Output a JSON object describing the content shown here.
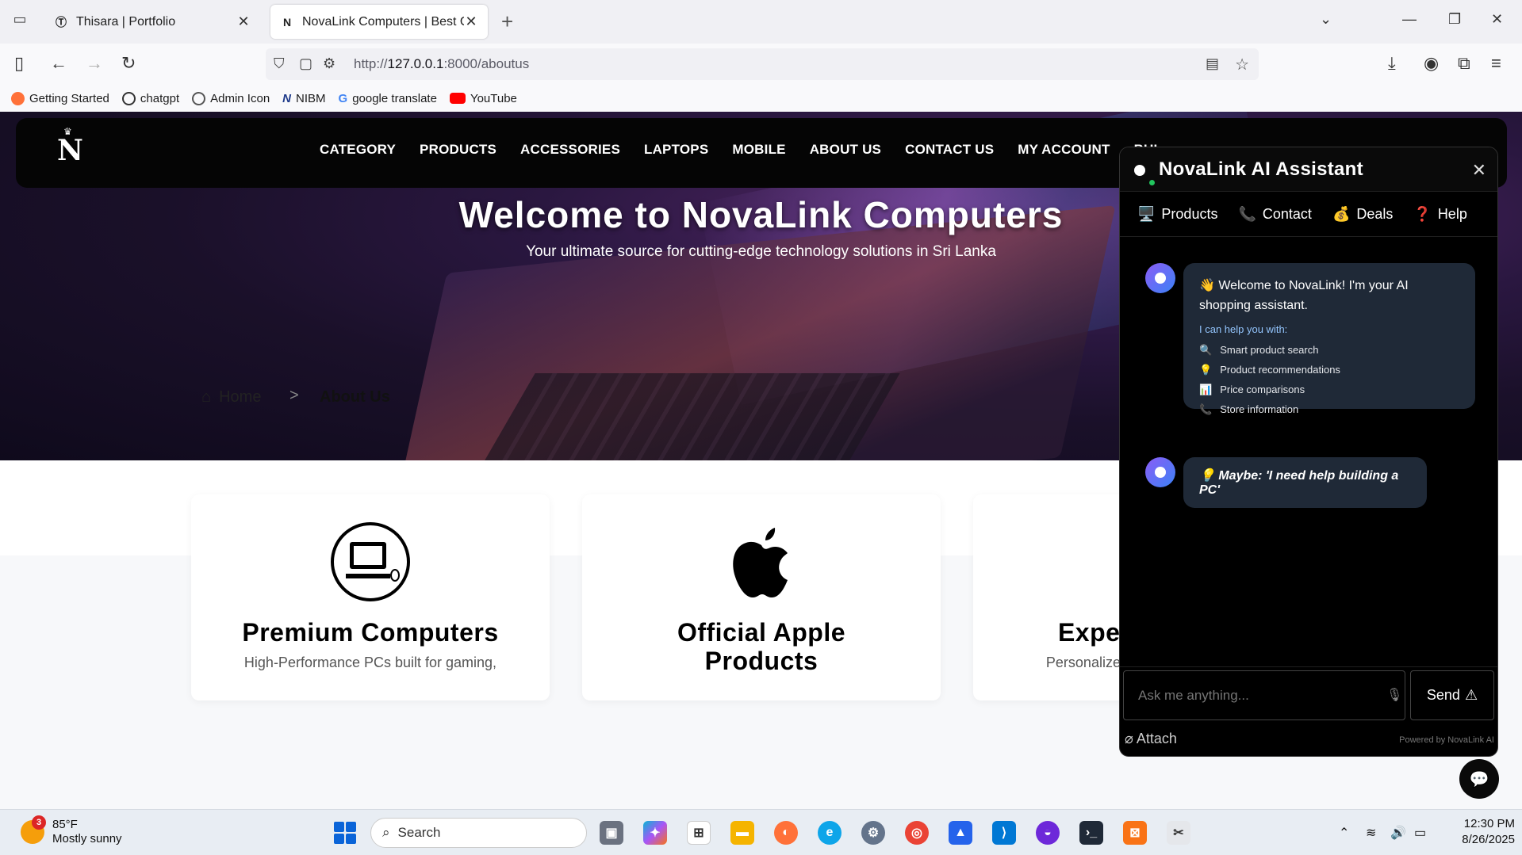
{
  "browser": {
    "tabs": [
      {
        "title": "Thisara | Portfolio",
        "active": false
      },
      {
        "title": "NovaLink Computers | Best Com",
        "active": true
      }
    ],
    "url_prefix": "http://",
    "url_host": "127.0.0.1",
    "url_rest": ":8000/aboutus",
    "bookmarks": [
      "Getting Started",
      "chatgpt",
      "Admin Icon",
      "NIBM",
      "google translate",
      "YouTube"
    ]
  },
  "site": {
    "logo": "N",
    "menu": [
      "CATEGORY",
      "PRODUCTS",
      "ACCESSORIES",
      "LAPTOPS",
      "MOBILE",
      "ABOUT US",
      "CONTACT US",
      "MY ACCOUNT",
      "BUI"
    ],
    "hero_title": "Welcome to NovaLink Computers",
    "hero_subtitle": "Your ultimate source for cutting-edge technology solutions in Sri Lanka",
    "breadcrumb": {
      "home": "Home",
      "separator": ">",
      "current": "About Us"
    },
    "cards": [
      {
        "title": "Premium Computers",
        "desc": "High-Performance PCs built for gaming,",
        "icon": "computer-icon"
      },
      {
        "title": "Official Apple Products",
        "desc": "",
        "icon": "apple-icon"
      },
      {
        "title": "Expert Support",
        "desc": "Personalized tech assistance and",
        "icon": "support-icon"
      }
    ]
  },
  "chat": {
    "title": "NovaLink AI Assistant",
    "close": "✕",
    "tabs": [
      {
        "icon": "🖥️",
        "label": "Products"
      },
      {
        "icon": "📞",
        "label": "Contact"
      },
      {
        "icon": "💰",
        "label": "Deals"
      },
      {
        "icon": "❓",
        "label": "Help"
      }
    ],
    "welcome": "👋 Welcome to NovaLink! I'm your AI shopping assistant.",
    "help_heading": "I can help you with:",
    "help_items": [
      {
        "icon": "🔍",
        "text": "Smart product search"
      },
      {
        "icon": "💡",
        "text": "Product recommendations"
      },
      {
        "icon": "📊",
        "text": "Price comparisons"
      },
      {
        "icon": "📞",
        "text": "Store information"
      }
    ],
    "suggestion": "💡 Maybe: 'I need help building a PC'",
    "input_placeholder": "Ask me anything...",
    "send_label": "Send",
    "attach_label": "Attach",
    "powered_by": "Powered by NovaLink AI"
  },
  "taskbar": {
    "weather_temp": "85°F",
    "weather_desc": "Mostly sunny",
    "weather_badge": "3",
    "search_label": "Search",
    "time": "12:30 PM",
    "date": "8/26/2025"
  }
}
